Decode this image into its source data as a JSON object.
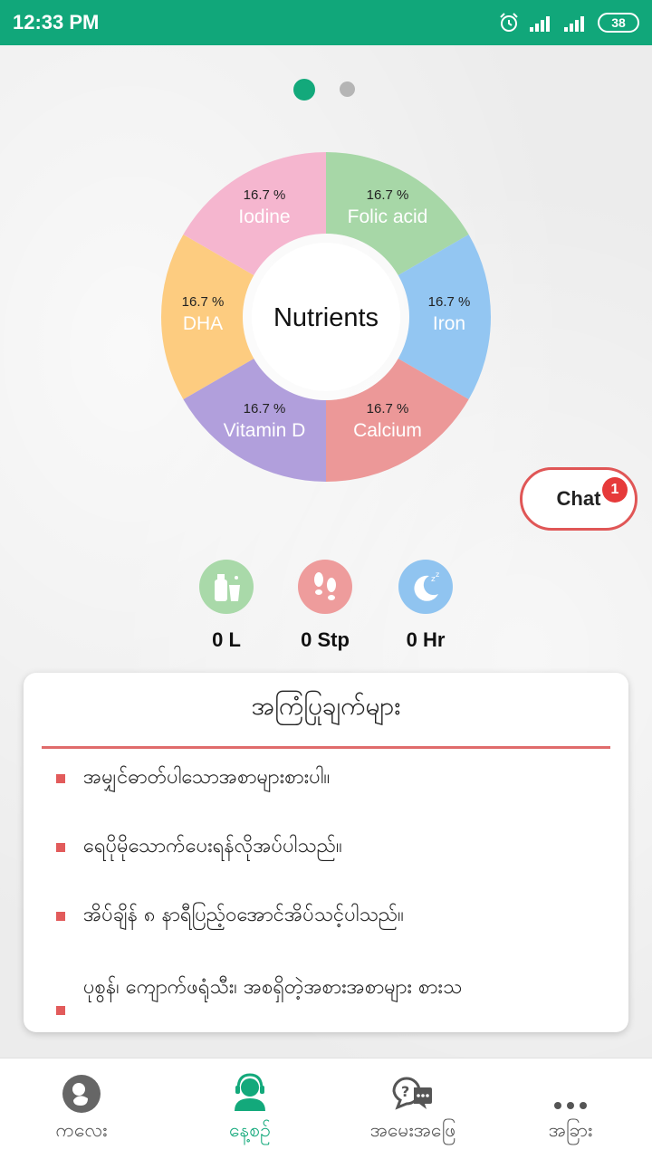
{
  "status_bar": {
    "time": "12:33 PM",
    "battery": "38"
  },
  "carousel": {
    "pages": 2,
    "active_index": 0
  },
  "chart_data": {
    "type": "pie",
    "title": "Nutrients",
    "slices": [
      {
        "label": "Folic acid",
        "value": 16.7,
        "value_label": "16.7 %",
        "color": "#a7d7a7"
      },
      {
        "label": "Iron",
        "value": 16.7,
        "value_label": "16.7 %",
        "color": "#93c6f2"
      },
      {
        "label": "Calcium",
        "value": 16.7,
        "value_label": "16.7 %",
        "color": "#ec9898"
      },
      {
        "label": "Vitamin D",
        "value": 16.7,
        "value_label": "16.7 %",
        "color": "#b19fdc"
      },
      {
        "label": "DHA",
        "value": 16.7,
        "value_label": "16.7 %",
        "color": "#fdcc80"
      },
      {
        "label": "Iodine",
        "value": 16.7,
        "value_label": "16.7 %",
        "color": "#f5b6cf"
      }
    ]
  },
  "chat": {
    "label": "Chat",
    "badge": "1"
  },
  "stats": [
    {
      "icon": "water-bottle-icon",
      "value": "0 L",
      "color": "#a9d9a9"
    },
    {
      "icon": "footsteps-icon",
      "value": "0 Stp",
      "color": "#ee9c9c"
    },
    {
      "icon": "moon-sleep-icon",
      "value": "0 Hr",
      "color": "#90c4f0"
    }
  ],
  "advice": {
    "title": "အကြံပြုချက်များ",
    "tips": [
      "အမျှင်ဓာတ်ပါသောအစာများစားပါ။",
      "ရေပိုမိုသောက်ပေးရန်လိုအပ်ပါသည်။",
      "အိပ်ချိန် ၈ နာရီပြည့်ဝအောင်အိပ်သင့်ပါသည်။",
      "ပုစွန်၊ ကျောက်ဖရုံသီး၊ အစရှိတဲ့အစားအစာများ စားသ"
    ]
  },
  "bottom_nav": [
    {
      "label": "ကလေး",
      "icon": "baby-icon",
      "active": false
    },
    {
      "label": "နေ့စဉ်",
      "icon": "headset-agent-icon",
      "active": true
    },
    {
      "label": "အမေးအဖြေ",
      "icon": "question-chat-icon",
      "active": false
    },
    {
      "label": "အခြား",
      "icon": "more-dots-icon",
      "active": false
    }
  ]
}
